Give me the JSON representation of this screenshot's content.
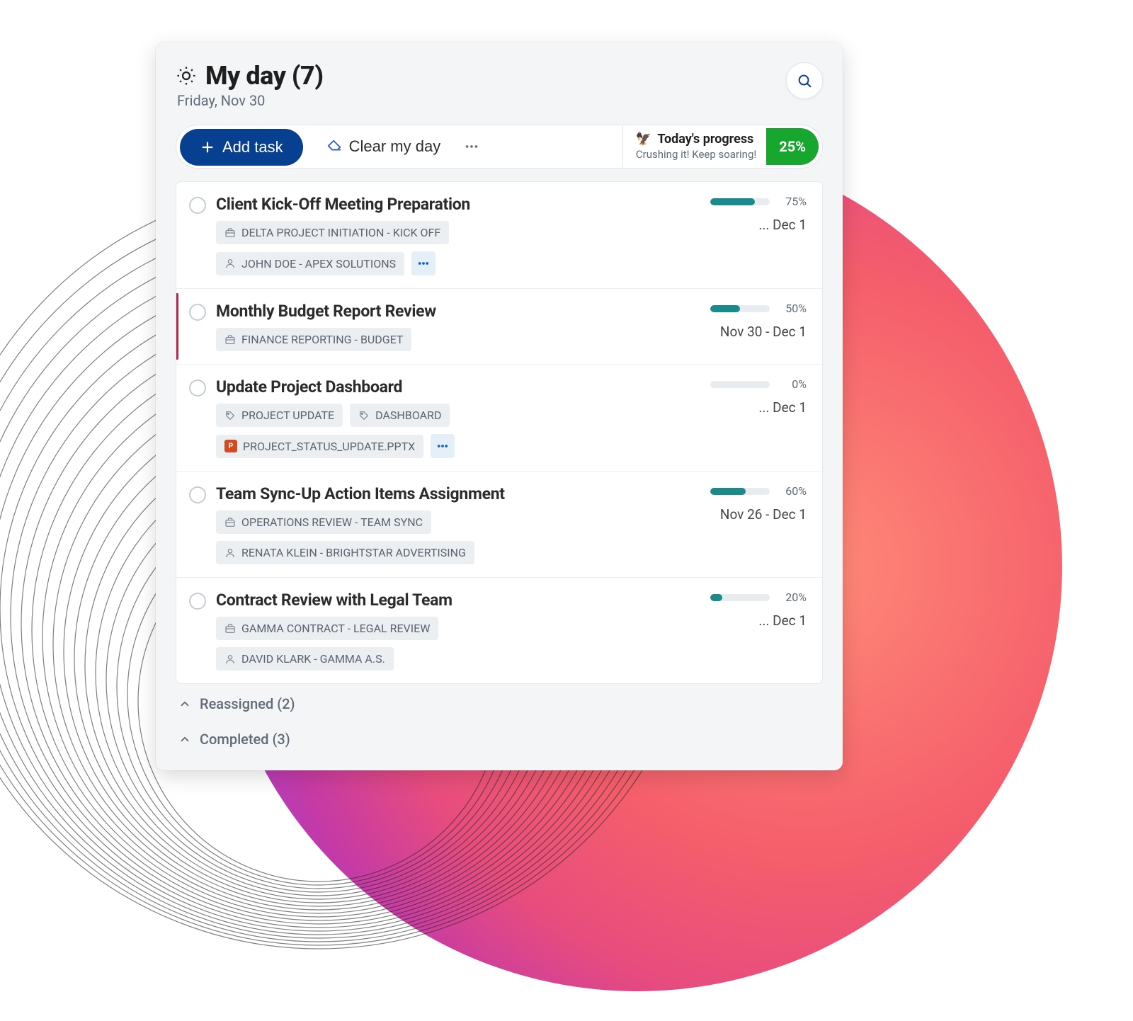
{
  "header": {
    "title": "My day (7)",
    "date": "Friday, Nov 30"
  },
  "toolbar": {
    "add_task": "Add task",
    "clear_my_day": "Clear my day",
    "progress_label": "Today's progress",
    "progress_sub": "Crushing it! Keep soaring!",
    "progress_pct": "25%"
  },
  "tasks": [
    {
      "title": "Client Kick-Off Meeting Preparation",
      "pct": 75,
      "pct_label": "75%",
      "date": "... Dec 1",
      "flagged": false,
      "chips": [
        {
          "icon": "briefcase",
          "label": "DELTA PROJECT INITIATION - KICK OFF"
        }
      ],
      "chips2": [
        {
          "icon": "person",
          "label": "JOHN DOE - APEX SOLUTIONS",
          "more": true
        }
      ]
    },
    {
      "title": "Monthly Budget Report Review",
      "pct": 50,
      "pct_label": "50%",
      "date": "Nov 30 - Dec 1",
      "flagged": true,
      "chips": [
        {
          "icon": "briefcase",
          "label": "FINANCE REPORTING - BUDGET"
        }
      ],
      "chips2": []
    },
    {
      "title": "Update Project Dashboard",
      "pct": 0,
      "pct_label": "0%",
      "date": "... Dec 1",
      "flagged": false,
      "chips": [
        {
          "icon": "tag",
          "label": "PROJECT UPDATE"
        },
        {
          "icon": "tag",
          "label": "DASHBOARD"
        }
      ],
      "chips2": [
        {
          "icon": "pptx",
          "label": "PROJECT_STATUS_UPDATE.PPTX",
          "more": true
        }
      ]
    },
    {
      "title": "Team Sync-Up Action Items Assignment",
      "pct": 60,
      "pct_label": "60%",
      "date": "Nov 26 - Dec 1",
      "flagged": false,
      "chips": [
        {
          "icon": "briefcase",
          "label": "OPERATIONS REVIEW - TEAM SYNC"
        }
      ],
      "chips2": [
        {
          "icon": "person",
          "label": "RENATA KLEIN - BRIGHTSTAR ADVERTISING"
        }
      ]
    },
    {
      "title": "Contract Review with Legal Team",
      "pct": 20,
      "pct_label": "20%",
      "date": "... Dec 1",
      "flagged": false,
      "chips": [
        {
          "icon": "briefcase",
          "label": "GAMMA CONTRACT - LEGAL REVIEW"
        }
      ],
      "chips2": [
        {
          "icon": "person",
          "label": "DAVID KLARK - GAMMA A.S."
        }
      ]
    }
  ],
  "sections": {
    "reassigned": "Reassigned (2)",
    "completed": "Completed (3)"
  },
  "colors": {
    "primary": "#073f91",
    "teal": "#1a8a8a",
    "green": "#17a62e",
    "flag": "#c22147"
  }
}
